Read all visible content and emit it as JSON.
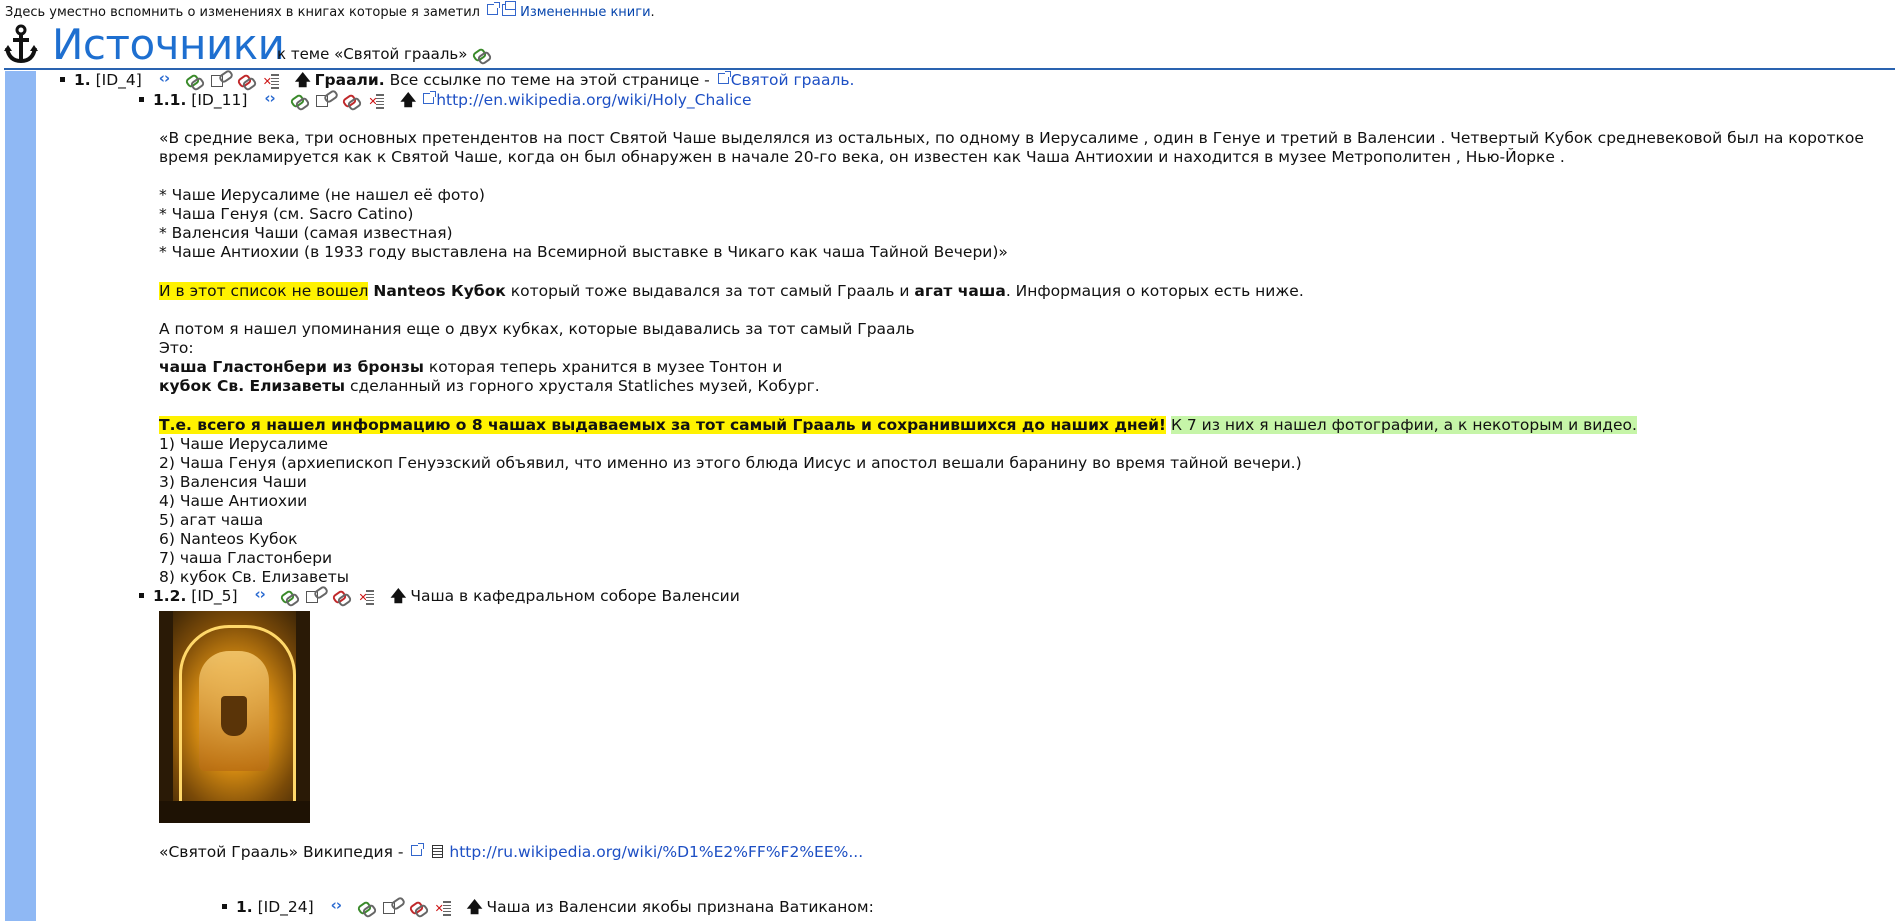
{
  "topnote": {
    "text": "Здесь уместно вспомнить о изменениях в книгах которые я заметил",
    "link": "Измененные книги",
    "tail": "."
  },
  "header": {
    "title": "Источники",
    "subtitle": "к теме «Святой грааль»"
  },
  "entry1": {
    "num": "1.",
    "id": "[ID_4]",
    "label": "Граали.",
    "text": "Все ссылке по теме на этой странице -",
    "link": "Святой грааль."
  },
  "entry11": {
    "num": "1.1.",
    "id": "[ID_11]",
    "url": "http://en.wikipedia.org/wiki/Holy_Chalice"
  },
  "body": {
    "p1a": "«В средние века, три основных претендентов на пост Святой Чаше выделялся из остальных, по одному в Иерусалиме , один в Генуе и третий в Валенсии . Четвертый Кубок средневековой был на короткое",
    "p1b": "время рекламируется как к Святой Чаше, когда он был обнаружен в начале 20-го века, он известен как Чаша Антиохии и находится в музее Метрополитен , Нью-Йорке .",
    "l1": "* Чаше Иерусалиме (не нашел её фото)",
    "l2": "* Чаша Генуя (см. Sacro Catino)",
    "l3": "* Валенсия Чаши (самая известная)",
    "l4": "* Чаше Антиохии (в 1933 году выставлена на Всемирной выставке в Чикаго как чаша Тайной Вечери)»",
    "p2_hl": "И в этот список не вошел",
    "p2_b1": "Nanteos Кубок",
    "p2_t1": "который тоже выдавался за тот самый Грааль и",
    "p2_b2": "агат чаша",
    "p2_t2": ". Информация о которых есть ниже.",
    "p3": "А потом я нашел упоминания еще о двух кубках, которые выдавались за тот самый Грааль",
    "p4": "Это:",
    "p5_b": "чаша Гластонбери из бронзы",
    "p5_t": "которая теперь хранится в музее Тонтон и",
    "p6_b": "кубок Св. Елизаветы",
    "p6_t": "сделанный из горного хрусталя Statliches музей, Кобург.",
    "p7_b": "Т.е. всего я нашел информацию о 8 чашах выдаваемых за тот самый Грааль и сохранившихся до наших дней!",
    "p7_g": "К 7 из них я нашел фотографии, а к некоторым и видео.",
    "n1": "1) Чаше Иерусалиме",
    "n2": "2) Чаша Генуя (архиепископ Генуэзский объявил, что именно из этого блюда Иисус и апостол вешали баранину во время тайной вечери.)",
    "n3": "3) Валенсия Чаши",
    "n4": "4) Чаше Антиохии",
    "n5": "5) агат чаша",
    "n6": "6) Nanteos Кубок",
    "n7": "7) чаша Гластонбери",
    "n8": "8) кубок Св. Елизаветы"
  },
  "entry12": {
    "num": "1.2.",
    "id": "[ID_5]",
    "label": "Чаша в кафедральном соборе Валенсии"
  },
  "source12": {
    "text": "«Святой Грааль» Википедия -",
    "url": "http://ru.wikipedia.org/wiki/%D1%E2%FF%F2%EE%..."
  },
  "entry121": {
    "num": "1.",
    "id": "[ID_24]",
    "label": "Чаша из Валенсии якобы признана Ватиканом:"
  }
}
